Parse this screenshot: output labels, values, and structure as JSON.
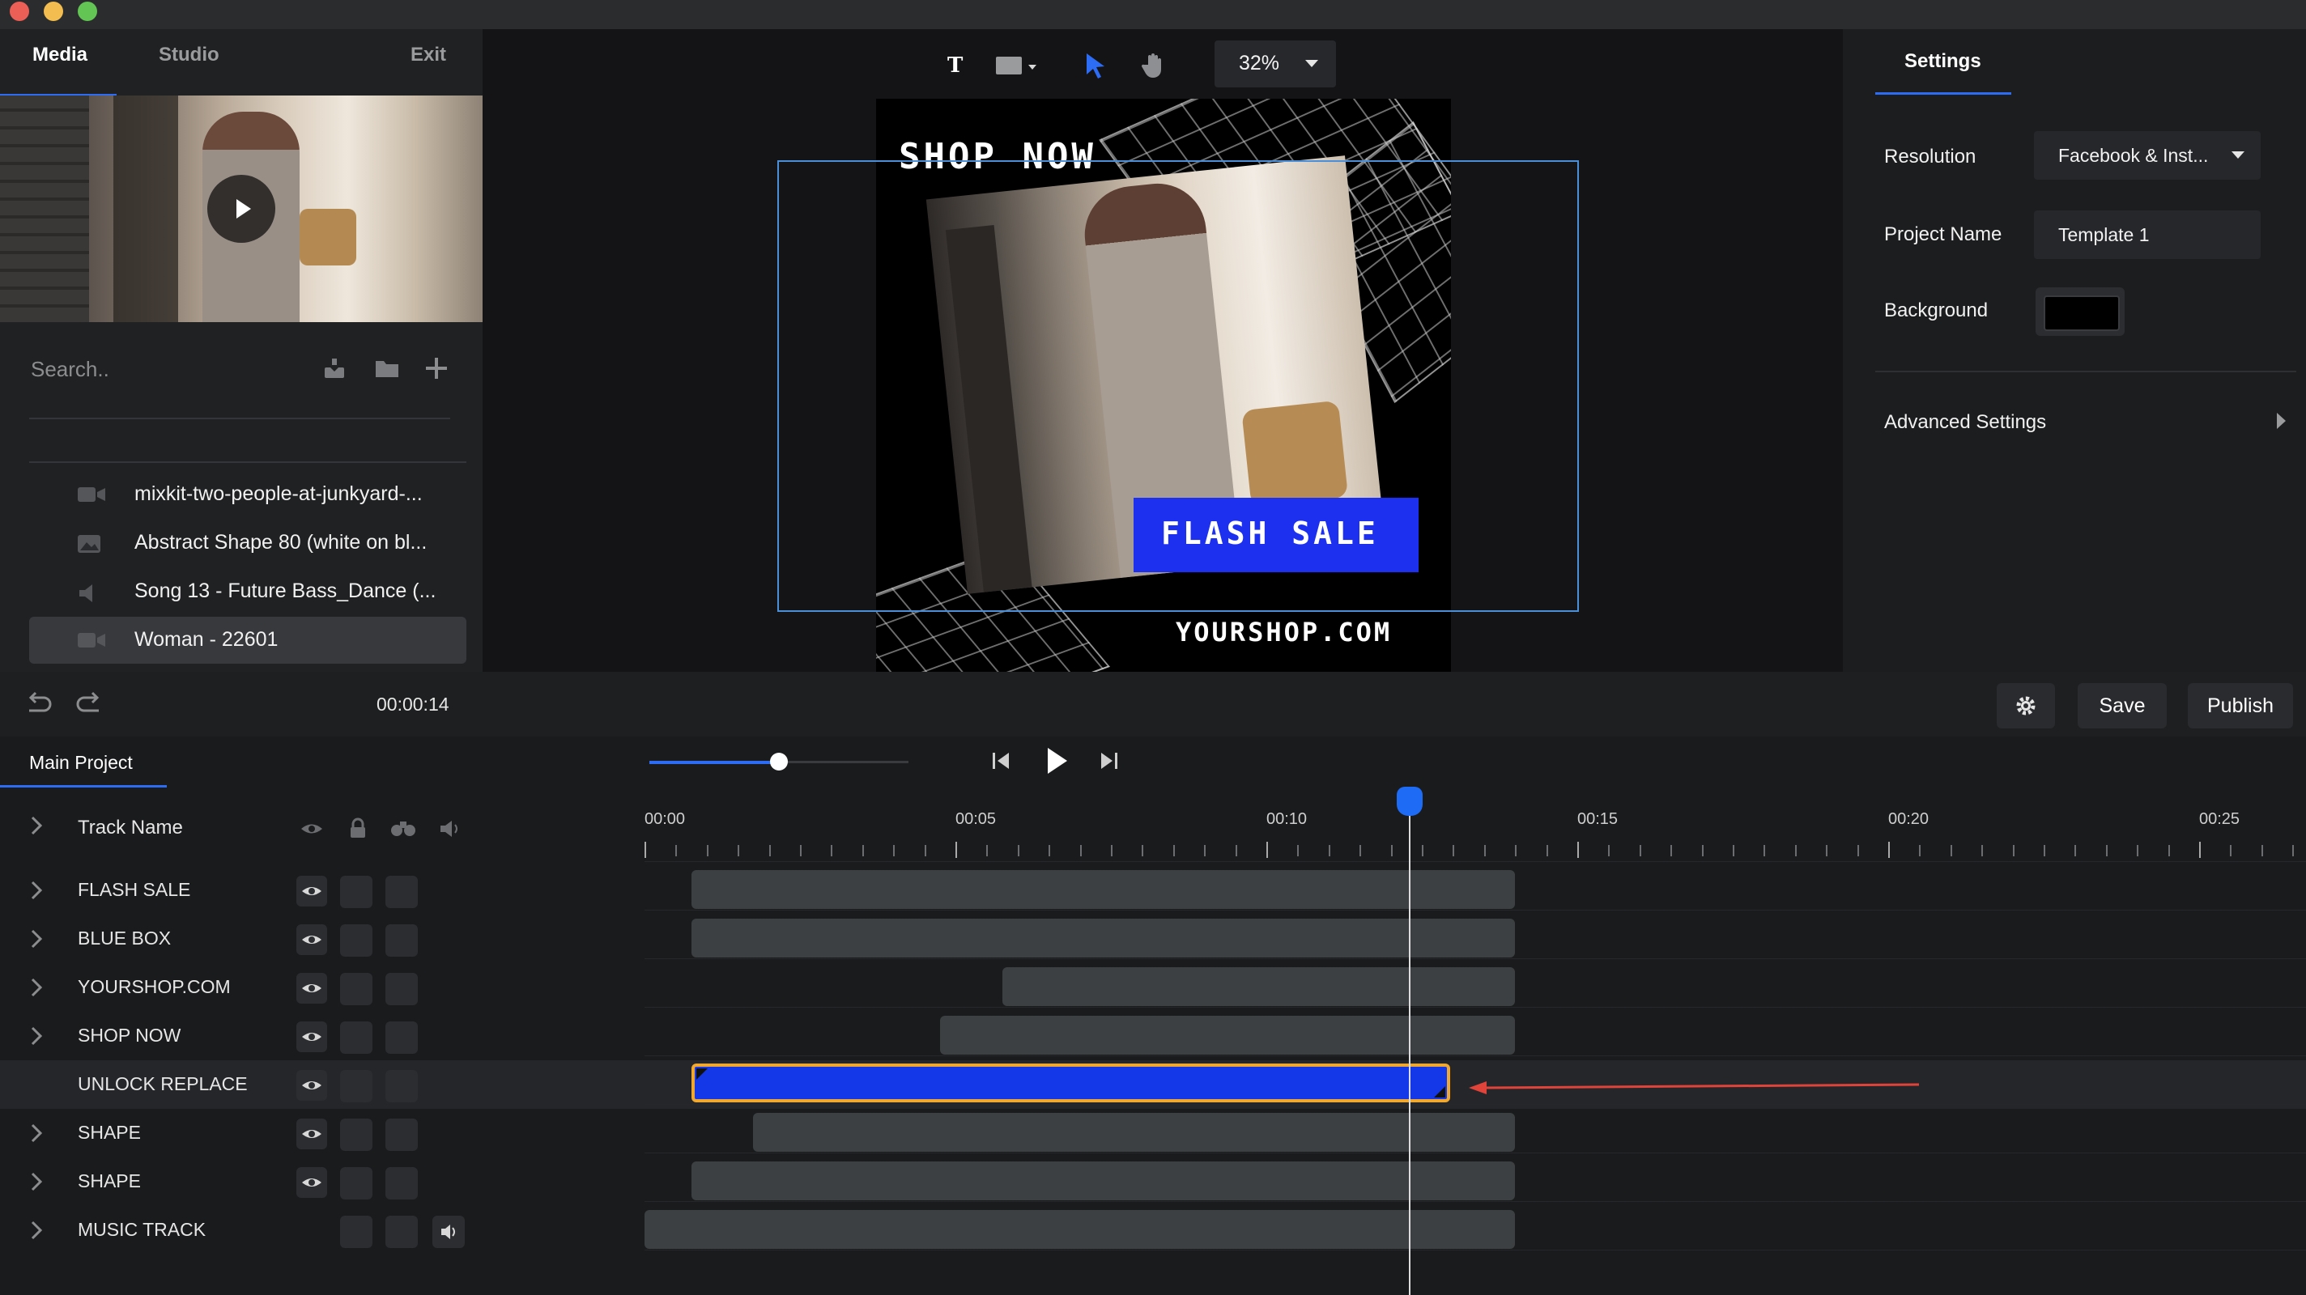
{
  "window": {
    "title_lights": [
      "#ec5f57",
      "#f4bd4f",
      "#62c554"
    ]
  },
  "left_panel": {
    "tabs": {
      "media": "Media",
      "studio": "Studio",
      "exit": "Exit"
    },
    "search": {
      "placeholder": "Search.."
    },
    "media_items": [
      {
        "label": "mixkit-two-people-at-junkyard-...",
        "icon": "video-icon"
      },
      {
        "label": "Abstract Shape 80 (white on bl...",
        "icon": "image-icon"
      },
      {
        "label": "Song 13 - Future Bass_Dance (...",
        "icon": "audio-icon"
      },
      {
        "label": "Woman - 22601",
        "icon": "video-icon",
        "selected": true
      }
    ],
    "current_time": "00:00:14"
  },
  "canvas": {
    "toolbar": {
      "text_tool": "T",
      "zoom": "32%"
    },
    "artboard": {
      "shop_now": "SHOP NOW",
      "flash_sale": "FLASH SALE",
      "url": "YOURSHOP.COM"
    }
  },
  "settings": {
    "tab": "Settings",
    "resolution_label": "Resolution",
    "resolution_value": "Facebook & Inst...",
    "project_name_label": "Project Name",
    "project_name_value": "Template 1",
    "background_label": "Background",
    "background_color": "#000000",
    "advanced": "Advanced Settings"
  },
  "controls": {
    "save": "Save",
    "publish": "Publish"
  },
  "timeline": {
    "tab": "Main Project",
    "track_header": "Track Name",
    "time_labels": [
      "00:00",
      "00:05",
      "00:10",
      "00:15",
      "00:20",
      "00:25"
    ],
    "playhead_time_seconds": 12.3,
    "volume_level": 0.5,
    "tracks": [
      {
        "name": "FLASH SALE",
        "start": 0.75,
        "end": 14
      },
      {
        "name": "BLUE BOX",
        "start": 0.75,
        "end": 14
      },
      {
        "name": "YOURSHOP.COM",
        "start": 5.75,
        "end": 14
      },
      {
        "name": "SHOP NOW",
        "start": 4.75,
        "end": 14
      },
      {
        "name": "UNLOCK REPLACE",
        "start": 0.75,
        "end": 12.85,
        "selected": true
      },
      {
        "name": "SHAPE",
        "start": 1.75,
        "end": 14
      },
      {
        "name": "SHAPE",
        "start": 0.75,
        "end": 14
      },
      {
        "name": "MUSIC TRACK",
        "start": 0,
        "end": 14
      }
    ]
  },
  "colors": {
    "accent": "#2d6cf5",
    "selected_clip": "#1437e8",
    "clip_outline": "#f0a830",
    "arrow": "#e0433a"
  }
}
